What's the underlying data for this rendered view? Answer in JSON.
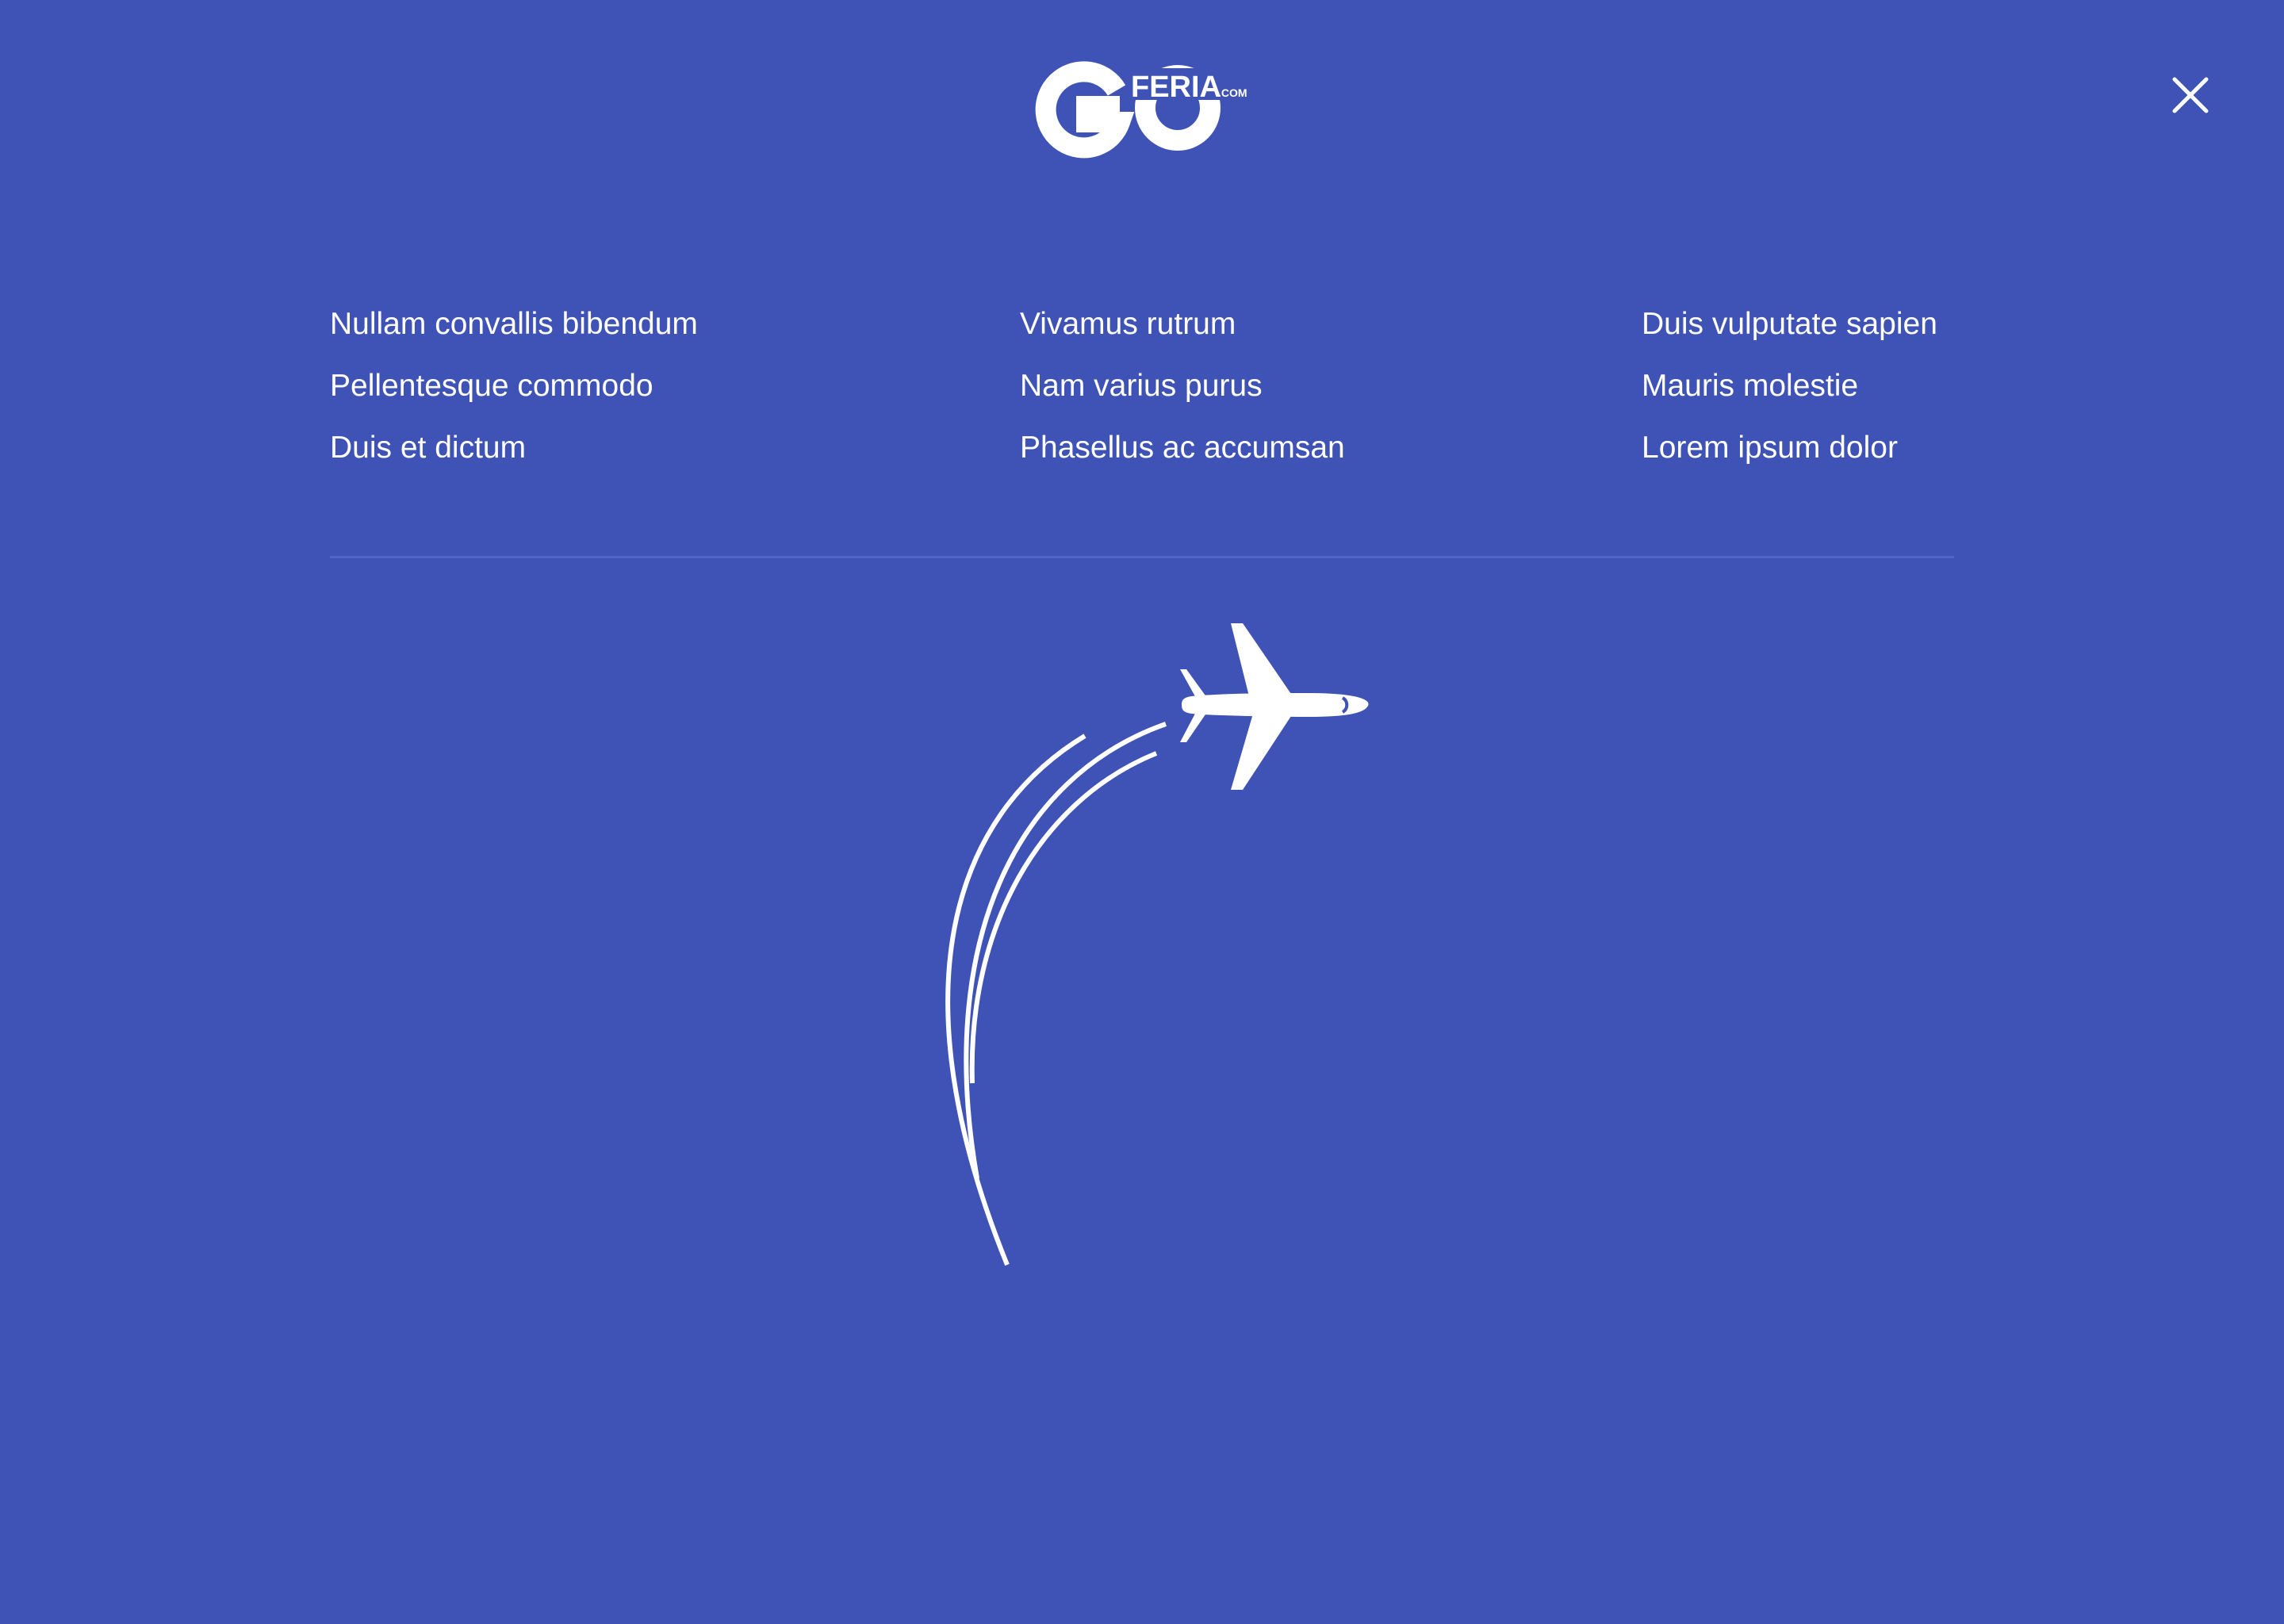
{
  "brand": {
    "logo_main": "GO",
    "logo_sub": "FERIA",
    "logo_suffix": ".COM"
  },
  "header": {
    "close_icon": "close-icon"
  },
  "menu": {
    "columns": [
      {
        "items": [
          "Nullam convallis bibendum",
          "Pellentesque commodo",
          "Duis et dictum"
        ]
      },
      {
        "items": [
          "Vivamus rutrum",
          "Nam varius purus",
          "Phasellus ac accumsan"
        ]
      },
      {
        "items": [
          "Duis vulputate sapien",
          "Mauris molestie",
          "Lorem ipsum dolor"
        ]
      }
    ]
  },
  "illustration": {
    "icon": "airplane-icon"
  },
  "colors": {
    "background": "#3f53b6",
    "foreground": "#ffffff",
    "divider": "#5066c6"
  }
}
